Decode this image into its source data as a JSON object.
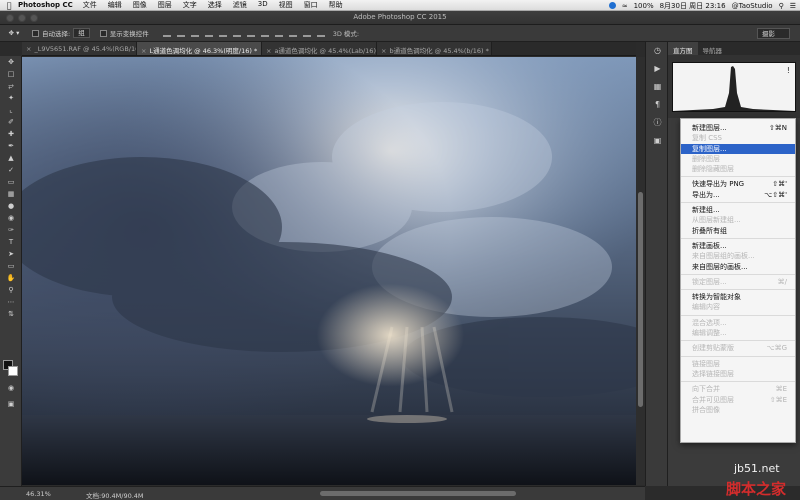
{
  "menubar": {
    "app_name": "Photoshop CC",
    "items": [
      "文件",
      "编辑",
      "图像",
      "图层",
      "文字",
      "选择",
      "滤镜",
      "3D",
      "视图",
      "窗口",
      "帮助"
    ],
    "battery": "100%",
    "datetime": "8月30日 周日  23:16",
    "user": "@TaoStudio"
  },
  "window": {
    "title": "Adobe Photoshop CC 2015"
  },
  "options": {
    "auto_select_label": "自动选择:",
    "auto_select_value": "组",
    "show_transform_label": "显示变换控件",
    "mode_3d": "3D 模式:",
    "workspace": "摄影"
  },
  "tabs": [
    {
      "label": "_L9V5651.RAF @ 45.4%(RGB/16*)"
    },
    {
      "label": "L通道色调均化 @ 46.3%(明度/16) *"
    },
    {
      "label": "a通道色调均化 @ 45.4%(Lab/16) *"
    },
    {
      "label": "b通道色调均化 @ 45.4%(b/16) *"
    }
  ],
  "status": {
    "zoom": "46.31%",
    "doc_size": "文档:90.4M/90.4M"
  },
  "panel": {
    "tabs": [
      "直方图",
      "导航器"
    ],
    "warning": "!"
  },
  "context_menu": {
    "items": [
      {
        "label": "新建图层...",
        "shortcut": "⇧⌘N",
        "state": "normal"
      },
      {
        "label": "复制 CSS",
        "shortcut": "",
        "state": "disabled"
      },
      {
        "label": "复制图层...",
        "shortcut": "",
        "state": "highlighted"
      },
      {
        "label": "删除图层",
        "shortcut": "",
        "state": "disabled"
      },
      {
        "label": "删除隐藏图层",
        "shortcut": "",
        "state": "disabled"
      },
      {
        "sep": true
      },
      {
        "label": "快速导出为 PNG",
        "shortcut": "⇧⌘'",
        "state": "normal"
      },
      {
        "label": "导出为...",
        "shortcut": "⌥⇧⌘'",
        "state": "normal"
      },
      {
        "sep": true
      },
      {
        "label": "新建组...",
        "shortcut": "",
        "state": "normal"
      },
      {
        "label": "从图层新建组...",
        "shortcut": "",
        "state": "disabled"
      },
      {
        "label": "折叠所有组",
        "shortcut": "",
        "state": "normal"
      },
      {
        "sep": true
      },
      {
        "label": "新建画板...",
        "shortcut": "",
        "state": "normal"
      },
      {
        "label": "来自图层组的画板...",
        "shortcut": "",
        "state": "disabled"
      },
      {
        "label": "来自图层的画板...",
        "shortcut": "",
        "state": "normal"
      },
      {
        "sep": true
      },
      {
        "label": "锁定图层...",
        "shortcut": "⌘/",
        "state": "disabled"
      },
      {
        "sep": true
      },
      {
        "label": "转换为智能对象",
        "shortcut": "",
        "state": "normal"
      },
      {
        "label": "编辑内容",
        "shortcut": "",
        "state": "disabled"
      },
      {
        "sep": true
      },
      {
        "label": "混合选项...",
        "shortcut": "",
        "state": "disabled"
      },
      {
        "label": "编辑调整...",
        "shortcut": "",
        "state": "disabled"
      },
      {
        "sep": true
      },
      {
        "label": "创建剪贴蒙版",
        "shortcut": "⌥⌘G",
        "state": "disabled"
      },
      {
        "sep": true
      },
      {
        "label": "链接图层",
        "shortcut": "",
        "state": "disabled"
      },
      {
        "label": "选择链接图层",
        "shortcut": "",
        "state": "disabled"
      },
      {
        "sep": true
      },
      {
        "label": "向下合并",
        "shortcut": "⌘E",
        "state": "disabled"
      },
      {
        "label": "合并可见图层",
        "shortcut": "⇧⌘E",
        "state": "disabled"
      },
      {
        "label": "拼合图像",
        "shortcut": "",
        "state": "disabled"
      }
    ]
  },
  "watermark": {
    "site": "jb51.net",
    "name": "脚本之家"
  },
  "colors": {
    "highlight": "#2c63c8",
    "workspace_bg": "#2b2b2b"
  }
}
